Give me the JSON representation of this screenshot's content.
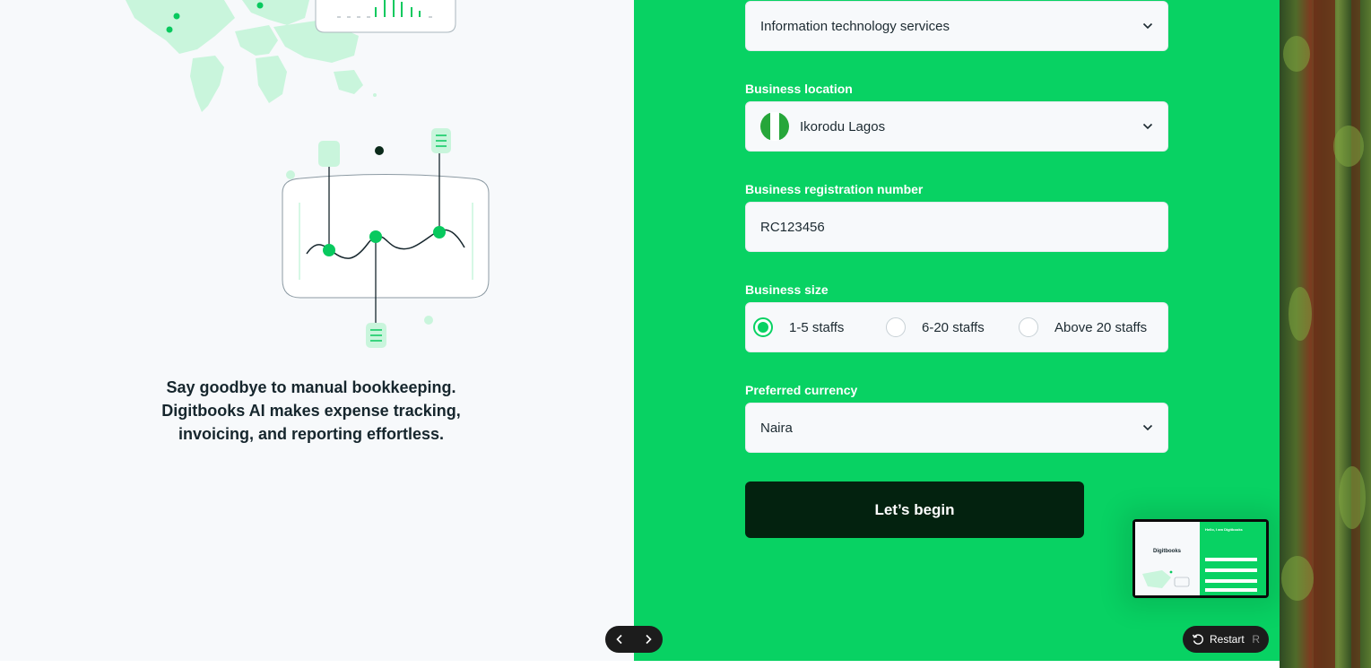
{
  "illustration": {
    "tagline": "Say goodbye to manual bookkeeping. Digitbooks AI makes expense tracking, invoicing, and reporting effortless."
  },
  "form": {
    "industry": {
      "value": "Information technology services"
    },
    "location": {
      "label": "Business location",
      "value": "Ikorodu Lagos"
    },
    "registration": {
      "label": "Business registration number",
      "value": "RC123456"
    },
    "size": {
      "label": "Business size",
      "options": [
        "1-5 staffs",
        "6-20 staffs",
        "Above 20 staffs"
      ],
      "selected": "1-5 staffs"
    },
    "currency": {
      "label": "Preferred currency",
      "value": "Naira"
    },
    "submit_label": "Let’s begin"
  },
  "thumbnail": {
    "logo_text": "Digitbooks",
    "heading": "Hello, I am Digitbooks"
  },
  "controls": {
    "restart_label": "Restart",
    "restart_shortcut": "R"
  },
  "colors": {
    "brand_green": "#08d263",
    "dark_button": "#03220f",
    "panel_bg": "#f7f9fb"
  }
}
